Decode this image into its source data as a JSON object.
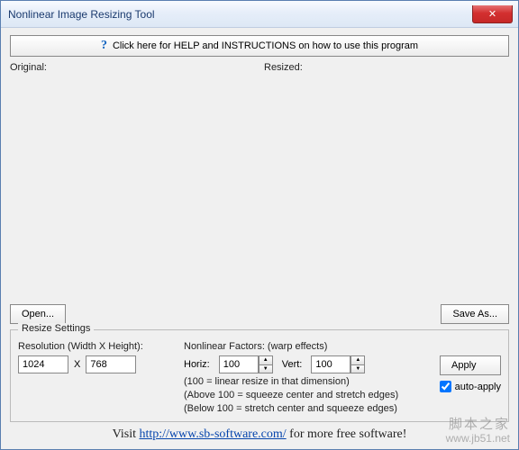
{
  "window": {
    "title": "Nonlinear Image Resizing Tool"
  },
  "help": {
    "label": "Click here for HELP and INSTRUCTIONS on how to use this program"
  },
  "panes": {
    "original": "Original:",
    "resized": "Resized:"
  },
  "buttons": {
    "open": "Open...",
    "save_as": "Save As...",
    "apply": "Apply"
  },
  "settings": {
    "legend": "Resize Settings",
    "resolution_label": "Resolution (Width X Height):",
    "width": "1024",
    "x_sep": "X",
    "height": "768",
    "nonlinear_label": "Nonlinear Factors: (warp effects)",
    "horiz_label": "Horiz:",
    "horiz": "100",
    "vert_label": "Vert:",
    "vert": "100",
    "hint1": "(100 = linear  resize in that dimension)",
    "hint2": "(Above 100 = squeeze center and stretch edges)",
    "hint3": "(Below 100 = stretch center and squeeze edges)",
    "auto_apply_label": "auto-apply",
    "auto_apply_checked": true
  },
  "footer": {
    "prefix": "Visit ",
    "link_text": "http://www.sb-software.com/",
    "suffix": " for more free software!"
  },
  "watermark": {
    "line1": "脚本之家",
    "line2": "www.jb51.net"
  }
}
